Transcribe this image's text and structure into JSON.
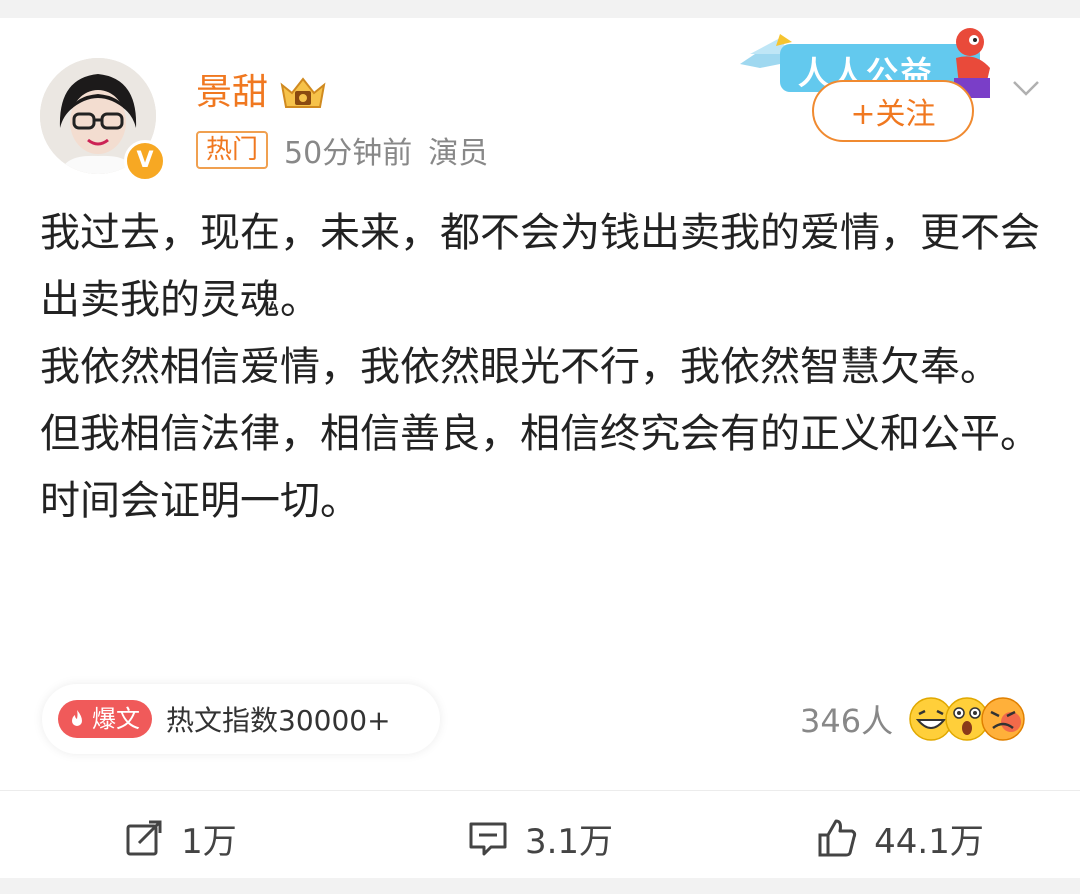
{
  "post": {
    "author": "景甜",
    "hot_tag": "热门",
    "time": "50分钟前",
    "role": "演员",
    "promo_text": "人人公益",
    "follow_label": "+关注",
    "content_lines": [
      "我过去，现在，未来，都不会为钱出卖我的爱情，更不会出卖我的灵魂。",
      "我依然相信爱情，我依然眼光不行，我依然智慧欠奉。",
      "但我相信法律，相信善良，相信终究会有的正义和公平。",
      "时间会证明一切。"
    ]
  },
  "hot_index": {
    "badge": "爆文",
    "text": "热文指数30000+"
  },
  "reactions": {
    "count": "346人"
  },
  "actions": {
    "repost": "1万",
    "comment": "3.1万",
    "like": "44.1万"
  },
  "colors": {
    "username": "#f07820",
    "accent": "#f08a30",
    "bao": "#f05a5a"
  }
}
